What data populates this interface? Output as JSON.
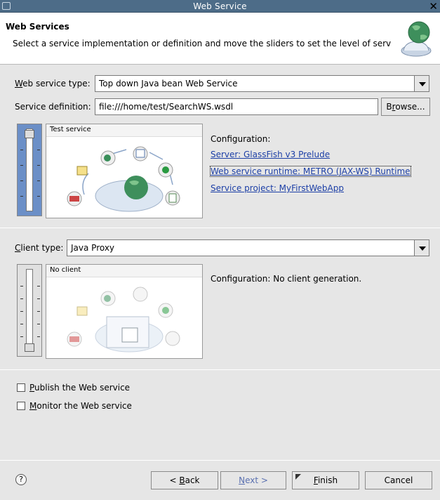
{
  "window": {
    "title": "Web Service"
  },
  "header": {
    "title": "Web Services",
    "description": "Select a service implementation or definition and move the sliders to set the level of serv"
  },
  "service": {
    "type_label_prefix": "",
    "type_label_mnemonic": "W",
    "type_label_rest": "eb service type:",
    "type_value": "Top down Java bean Web Service",
    "definition_label": "Service definition:",
    "definition_value": "file:///home/test/SearchWS.wsdl",
    "browse_pre": "B",
    "browse_mnemonic": "r",
    "browse_post": "owse...",
    "preview_title": "Test service",
    "config_heading": "Configuration:",
    "server_link": "Server: GlassFish v3 Prelude",
    "runtime_link": "Web service runtime: METRO (JAX-WS) Runtime",
    "project_link": "Service project: MyFirstWebApp"
  },
  "client": {
    "type_label_mnemonic": "C",
    "type_label_rest": "lient type:",
    "type_value": "Java Proxy",
    "preview_title": "No client",
    "config_text": "Configuration: No client generation."
  },
  "options": {
    "publish_mnemonic": "P",
    "publish_rest": "ublish the Web service",
    "monitor_mnemonic": "M",
    "monitor_rest": "onitor the Web service",
    "publish_checked": false,
    "monitor_checked": false
  },
  "footer": {
    "help_glyph": "?",
    "back_pre": "< ",
    "back_mnemonic": "B",
    "back_post": "ack",
    "next_mnemonic": "N",
    "next_post": "ext >",
    "finish_mnemonic": "F",
    "finish_post": "inish",
    "cancel_label": "Cancel"
  },
  "colors": {
    "titlebar": "#4d6c88",
    "link": "#1c3fa6",
    "slider_active": "#6b8fc7"
  }
}
